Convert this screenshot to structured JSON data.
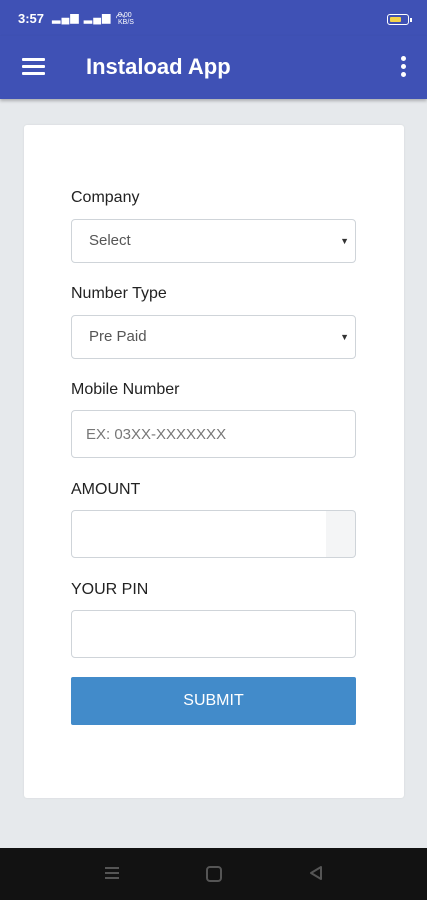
{
  "status_bar": {
    "time": "3:57",
    "signal_icons": "▂▄▆ ▂▄▆ ◠",
    "speed_value": "0.00",
    "speed_unit": "KB/S",
    "battery_color": "#f5d34a"
  },
  "app_bar": {
    "title": "Instaload App",
    "background": "#3f51b5"
  },
  "form": {
    "company": {
      "label": "Company",
      "selected": "Select"
    },
    "number_type": {
      "label": "Number Type",
      "selected": "Pre Paid"
    },
    "mobile_number": {
      "label": "Mobile Number",
      "placeholder": "EX: 03XX-XXXXXXX",
      "value": ""
    },
    "amount": {
      "label": "AMOUNT",
      "value": ""
    },
    "pin": {
      "label": "YOUR PIN",
      "value": ""
    },
    "submit_label": "SUBMIT",
    "submit_color": "#428bca"
  },
  "icons": {
    "menu": "menu-icon",
    "more": "more-vert-icon",
    "dropdown": "▼",
    "nav_recents": "recents-icon",
    "nav_home": "home-icon",
    "nav_back": "back-icon"
  }
}
